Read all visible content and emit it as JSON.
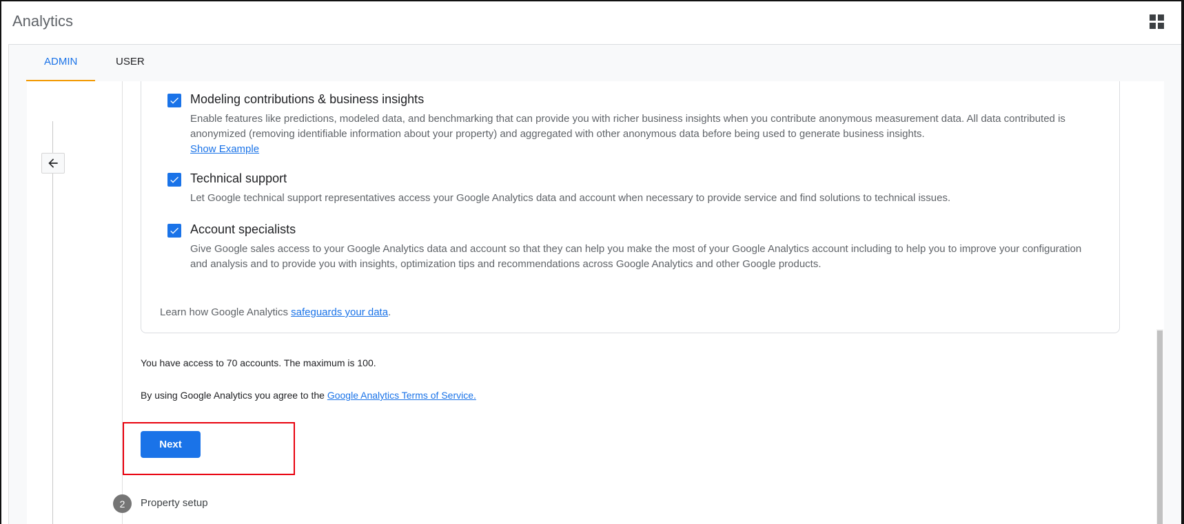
{
  "app": {
    "title": "Analytics",
    "apps_icon": "apps-grid-icon"
  },
  "tabs": [
    {
      "label": "ADMIN",
      "active": true
    },
    {
      "label": "USER",
      "active": false
    }
  ],
  "settings": {
    "options": [
      {
        "title": "Modeling contributions & business insights",
        "description": "Enable features like predictions, modeled data, and benchmarking that can provide you with richer business insights when you contribute anonymous measurement data. All data contributed is anonymized (removing identifiable information about your property) and aggregated with other anonymous data before being used to generate business insights.",
        "link": "Show Example",
        "checked": true
      },
      {
        "title": "Technical support",
        "description": "Let Google technical support representatives access your Google Analytics data and account when necessary to provide service and find solutions to technical issues.",
        "checked": true
      },
      {
        "title": "Account specialists",
        "description": "Give Google sales access to your Google Analytics data and account so that they can help you make the most of your Google Analytics account including to help you to improve your configuration and analysis and to provide you with insights, optimization tips and recommendations across Google Analytics and other Google products.",
        "checked": true
      }
    ],
    "learn_prefix": "Learn how Google Analytics ",
    "learn_link": "safeguards your data",
    "learn_suffix": "."
  },
  "account_limit": "You have access to 70 accounts. The maximum is 100.",
  "terms": {
    "prefix": "By using Google Analytics you agree to the ",
    "link": "Google Analytics Terms of Service."
  },
  "next_button": "Next",
  "next_step": {
    "number": "2",
    "label": "Property setup"
  },
  "colors": {
    "accent": "#1a73e8",
    "tab_indicator": "#f29900",
    "highlight": "#e8000d"
  }
}
